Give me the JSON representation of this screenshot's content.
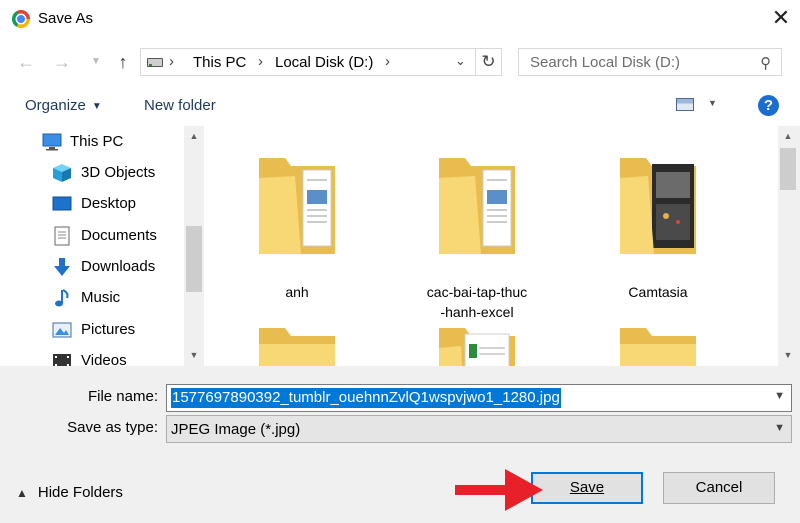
{
  "window": {
    "title": "Save As",
    "close_glyph": "✕"
  },
  "nav": {
    "back_icon": "arrow-left-icon",
    "forward_icon": "arrow-right-icon",
    "up_icon": "arrow-up-icon",
    "breadcrumb": [
      "This PC",
      "Local Disk (D:)"
    ],
    "search_placeholder": "Search Local Disk (D:)"
  },
  "toolbar": {
    "organize_label": "Organize",
    "new_folder_label": "New folder",
    "help_label": "?"
  },
  "navpane": {
    "items": [
      {
        "label": "This PC",
        "icon": "monitor-icon"
      },
      {
        "label": "3D Objects",
        "icon": "cube-icon"
      },
      {
        "label": "Desktop",
        "icon": "desktop-icon"
      },
      {
        "label": "Documents",
        "icon": "documents-icon"
      },
      {
        "label": "Downloads",
        "icon": "download-icon"
      },
      {
        "label": "Music",
        "icon": "music-icon"
      },
      {
        "label": "Pictures",
        "icon": "pictures-icon"
      },
      {
        "label": "Videos",
        "icon": "videos-icon"
      }
    ]
  },
  "content": {
    "folders": [
      {
        "label_lines": [
          "anh",
          ""
        ],
        "icon": "folder-documents-icon"
      },
      {
        "label_lines": [
          "cac-bai-tap-thuc",
          "-hanh-excel"
        ],
        "icon": "folder-documents-icon"
      },
      {
        "label_lines": [
          "Camtasia",
          ""
        ],
        "icon": "folder-photos-icon"
      },
      {
        "label_lines": [
          "",
          ""
        ],
        "icon": "folder-icon"
      },
      {
        "label_lines": [
          "",
          ""
        ],
        "icon": "folder-spreadsheet-icon"
      },
      {
        "label_lines": [
          "",
          ""
        ],
        "icon": "folder-icon"
      }
    ]
  },
  "form": {
    "file_name_label": "File name:",
    "file_name_value": "1577697890392_tumblr_ouehnnZvlQ1wspvjwo1_1280.jpg",
    "save_type_label": "Save as type:",
    "save_type_value": "JPEG Image (*.jpg)",
    "hide_folders_label": "Hide Folders"
  },
  "buttons": {
    "save_label": "Save",
    "cancel_label": "Cancel"
  },
  "colors": {
    "accent": "#0078d7",
    "folder": "#f8d775",
    "annotation_arrow": "#e8202a",
    "help": "#1c6dd0"
  }
}
